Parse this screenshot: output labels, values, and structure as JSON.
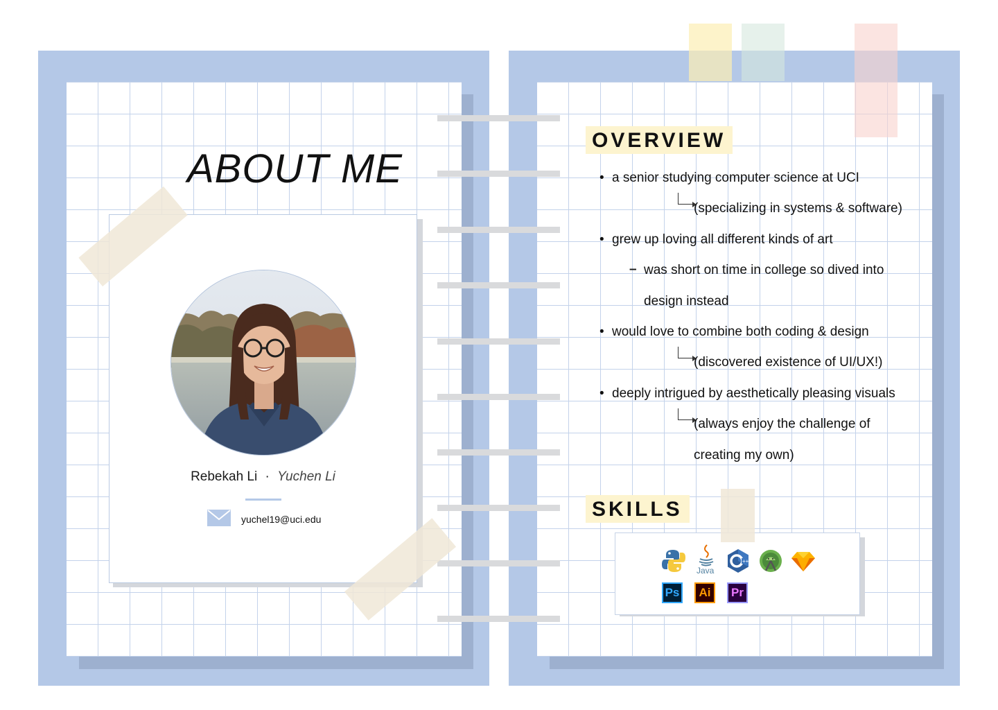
{
  "left_page": {
    "title": "ABOUT ME",
    "profile": {
      "name": "Rebekah Li",
      "separator": "·",
      "alt_name": "Yuchen Li",
      "email": "yuchel19@uci.edu"
    }
  },
  "right_page": {
    "overview": {
      "heading": "OVERVIEW",
      "lines": [
        "a senior studying computer science at UCI",
        "(specializing in systems & software)",
        "grew up loving all different kinds of art",
        "was short on time in college so dived into",
        "design instead",
        "would love to combine both coding & design",
        "(discovered existence of UI/UX!)",
        "deeply intrigued by aesthetically pleasing visuals",
        "(always enjoy the challenge of",
        "creating my own)"
      ]
    },
    "skills": {
      "heading": "SKILLS",
      "icons": [
        "python-icon",
        "java-icon",
        "c-plus-plus-icon",
        "android-studio-icon",
        "sketch-icon",
        "photoshop-icon",
        "illustrator-icon",
        "premiere-icon"
      ],
      "java_label": "Java",
      "ps_label": "Ps",
      "ai_label": "Ai",
      "pr_label": "Pr"
    }
  },
  "colors": {
    "cover": "#b4c8e7",
    "cover_shadow": "#9db0cf",
    "heading_highlight": "#fdf4cf",
    "grid_line": "#c3d2ea"
  }
}
